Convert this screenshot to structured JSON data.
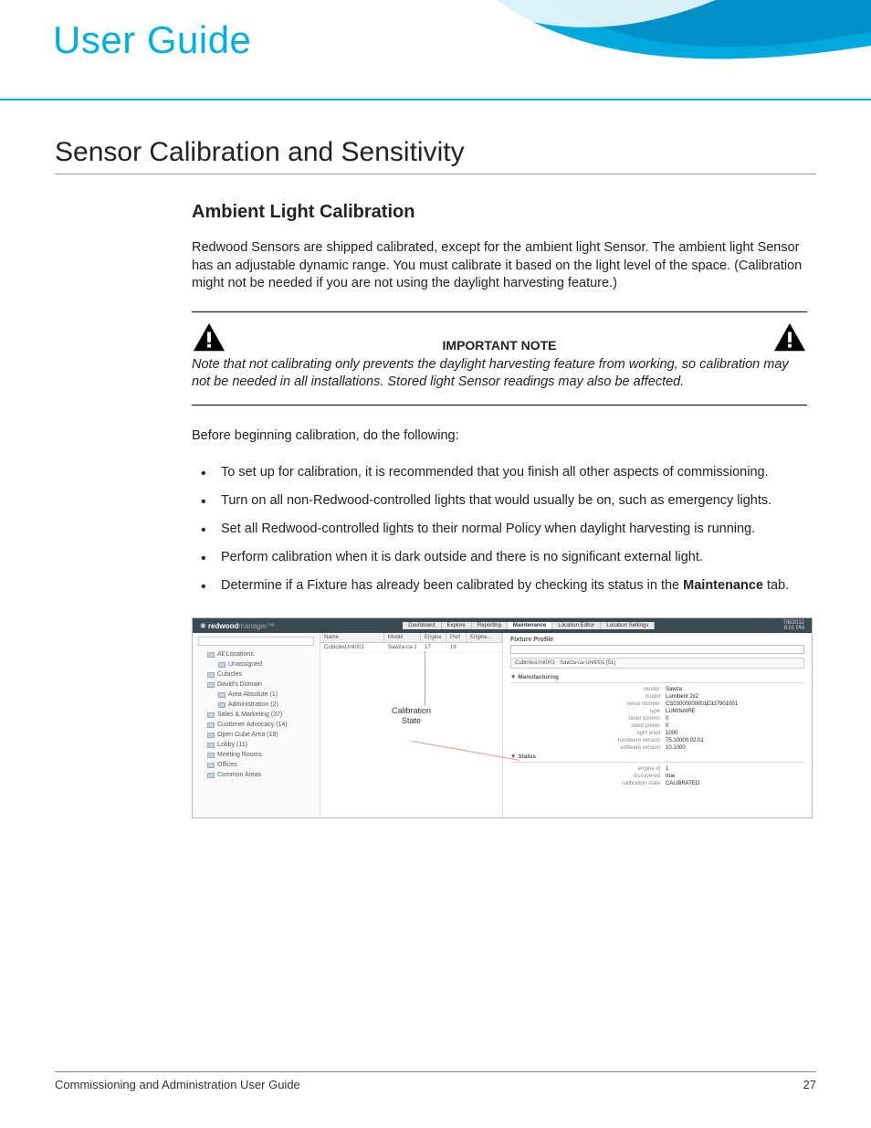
{
  "header": {
    "title": "User Guide"
  },
  "section": {
    "h1": "Sensor Calibration and Sensitivity",
    "h2": "Ambient Light Calibration",
    "intro": "Redwood Sensors are shipped calibrated, except for the ambient light Sensor. The ambient light Sensor has an adjustable dynamic range. You must calibrate it based on the light level of the space. (Calibration might not be needed if you are not using the daylight harvesting feature.)",
    "note": {
      "title": "IMPORTANT NOTE",
      "body": "Note that not calibrating only prevents the daylight harvesting feature from working, so calibration may not be needed in all installations. Stored light Sensor readings may also be affected."
    },
    "lead": "Before beginning calibration, do the following:",
    "bullets": [
      "To set up for calibration, it is recommended that you finish all other aspects of commissioning.",
      "Turn on all non-Redwood-controlled lights that would usually be on, such as emergency lights.",
      "Set all Redwood-controlled lights to their normal Policy when daylight harvesting is running.",
      "Perform calibration when it is dark outside and there is no significant external light."
    ],
    "bullet5_pre": "Determine if a Fixture has already been calibrated by checking its status in the ",
    "bullet5_bold": "Maintenance",
    "bullet5_post": " tab."
  },
  "screenshot": {
    "brand_bold": "redwood",
    "brand_light": "manager™",
    "tabs": [
      "Dashboard",
      "Explore",
      "Reporting",
      "Maintenance",
      "Location Editor",
      "Location Settings"
    ],
    "time": "7/8/2012\n9:01 PM",
    "tree": [
      {
        "lvl": 1,
        "label": "All Locations"
      },
      {
        "lvl": 2,
        "label": "Unassigned"
      },
      {
        "lvl": 1,
        "label": "Cubicles"
      },
      {
        "lvl": 1,
        "label": "David's Domain"
      },
      {
        "lvl": 2,
        "label": "Area Absolute (1)"
      },
      {
        "lvl": 2,
        "label": "Administration (2)"
      },
      {
        "lvl": 1,
        "label": "Sales & Marketing (37)"
      },
      {
        "lvl": 1,
        "label": "Customer Advocacy (14)"
      },
      {
        "lvl": 1,
        "label": "Open Cube Area (19)"
      },
      {
        "lvl": 1,
        "label": "Lobby (11)"
      },
      {
        "lvl": 1,
        "label": "Meeting Rooms"
      },
      {
        "lvl": 1,
        "label": "Offices"
      },
      {
        "lvl": 1,
        "label": "Common Areas"
      }
    ],
    "mid_headers": [
      "Name",
      "Model",
      "Engine",
      "Port",
      "Engine…"
    ],
    "mid_row": [
      "CubiclesUnit001",
      "Sawza-ca-1",
      "17",
      "19",
      ""
    ],
    "callout": "Calibration\nState",
    "right": {
      "title": "Fixture Profile",
      "sub": "CubiclesUnit001 · Sawza-ca-Unit001 (51)",
      "sec1": "▼ Manufacturing",
      "kv1": [
        {
          "k": "vendor",
          "v": "Sawza"
        },
        {
          "k": "model",
          "v": "Lumibent 2x2"
        },
        {
          "k": "serial number",
          "v": "CS03000000001E337901001"
        },
        {
          "k": "type",
          "v": "LUMINAIRE"
        },
        {
          "k": "rated lumens",
          "v": "0"
        },
        {
          "k": "rated power",
          "v": "0"
        },
        {
          "k": "light level",
          "v": "1000"
        },
        {
          "k": "hardware version",
          "v": "75.10000.02.01"
        },
        {
          "k": "software version",
          "v": "10.1000"
        }
      ],
      "sec2": "▼ Status",
      "kv2": [
        {
          "k": "engine id",
          "v": "1"
        },
        {
          "k": "discovered",
          "v": "true"
        },
        {
          "k": "calibration state",
          "v": "CALIBRATED"
        }
      ]
    }
  },
  "footer": {
    "left": "Commissioning and Administration User Guide",
    "right": "27"
  }
}
